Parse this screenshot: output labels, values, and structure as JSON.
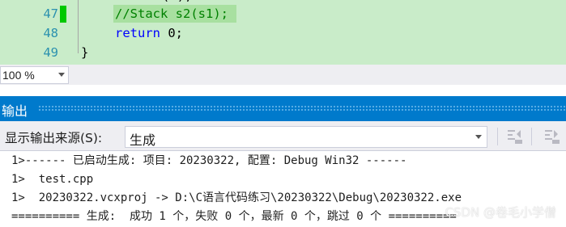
{
  "editor": {
    "partial_top_line": "(   ); ",
    "lines": [
      {
        "number": "47",
        "code": "//Stack s2(s1);"
      },
      {
        "number": "48",
        "keyword": "return",
        "rest": " 0;"
      },
      {
        "number": "49",
        "code": "}"
      }
    ]
  },
  "zoom": {
    "value": "100 %"
  },
  "output_panel": {
    "title": "输出",
    "source_label": "显示输出来源(S):",
    "source_value": "生成",
    "toolbar_icons": [
      "find-message-icon",
      "clear-all-icon"
    ],
    "lines": [
      "1>------ 已启动生成: 项目: 20230322, 配置: Debug Win32 ------",
      "1>  test.cpp",
      "1>  20230322.vcxproj -> D:\\C语言代码练习\\20230322\\Debug\\20230322.exe",
      "========== 生成:  成功 1 个，失败 0 个，最新 0 个，跳过 0 个 =========="
    ]
  },
  "watermark": "CSDN @卷毛小学僧",
  "colors": {
    "editor_bg": "#c9ecc9",
    "line_number": "#2b91af",
    "keyword": "#0000ff",
    "comment": "#008000",
    "change_bar": "#00c800",
    "titlebar": "#007acc"
  }
}
